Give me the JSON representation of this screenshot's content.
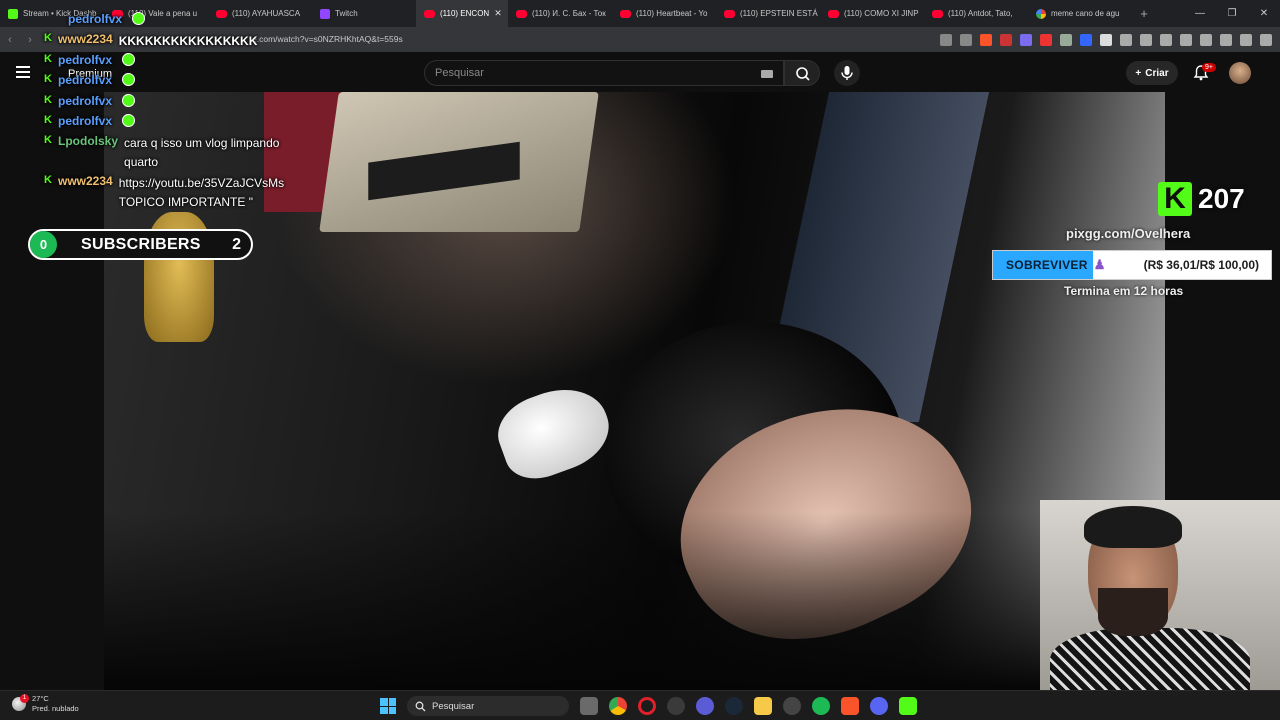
{
  "browser": {
    "tabs": [
      {
        "label": "Stream • Kick Dashb",
        "icon": "kick-icon",
        "color": "#53fc18"
      },
      {
        "label": "(110) Vale a pena u",
        "icon": "youtube-icon",
        "color": "#ff0033"
      },
      {
        "label": "(110) AYAHUASCA",
        "icon": "youtube-icon",
        "color": "#ff0033"
      },
      {
        "label": "Twitch",
        "icon": "twitch-icon",
        "color": "#9146ff"
      },
      {
        "label": "(110) ENCON",
        "icon": "youtube-icon",
        "color": "#ff0033",
        "active": true
      },
      {
        "label": "(110) И. С. Бах - Ток",
        "icon": "youtube-icon",
        "color": "#ff0033"
      },
      {
        "label": "(110) Heartbeat - Yo",
        "icon": "youtube-icon",
        "color": "#ff0033"
      },
      {
        "label": "(110) EPSTEIN ESTÁ",
        "icon": "youtube-icon",
        "color": "#ff0033"
      },
      {
        "label": "(110) COMO XI JINP",
        "icon": "youtube-icon",
        "color": "#ff0033"
      },
      {
        "label": "(110) Antdot, Tato,",
        "icon": "youtube-icon",
        "color": "#ff0033"
      },
      {
        "label": "meme cano de agu",
        "icon": "google-icon",
        "color": "#4285f4"
      }
    ],
    "new_tab": "+",
    "window_controls": {
      "minimize": "—",
      "restore": "❐",
      "close": "✕"
    },
    "url": "e.com/watch?v=s0NZRHKhtAQ&t=559s"
  },
  "youtube": {
    "premium_label": "Premium",
    "search_placeholder": "Pesquisar",
    "create_label": "Criar",
    "notification_count": "9+"
  },
  "chat": {
    "messages": [
      {
        "user": "pedrolfvx",
        "user_color": "#5aa0ff",
        "text": ""
      },
      {
        "user": "www2234",
        "user_color": "#f0c070",
        "text": "KKKKKKKKKKKKKKKK"
      },
      {
        "user": "pedrolfvx",
        "user_color": "#5aa0ff",
        "text": ""
      },
      {
        "user": "pedrolfvx",
        "user_color": "#5aa0ff",
        "text": ""
      },
      {
        "user": "pedrolfvx",
        "user_color": "#5aa0ff",
        "text": ""
      },
      {
        "user": "pedrolfvx",
        "user_color": "#5aa0ff",
        "text": ""
      },
      {
        "user": "Lpodolsky",
        "user_color": "#6ac47a",
        "text": "cara q isso um vlog limpando quarto"
      },
      {
        "user": "www2234",
        "user_color": "#f0c070",
        "text": "https://youtu.be/35VZaJCVsMs TOPICO IMPORTANTE \""
      }
    ]
  },
  "subscribers_goal": {
    "current": "0",
    "label": "SUBSCRIBERS",
    "goal": "2"
  },
  "viewer_count": {
    "value": "207",
    "icon": "kick-icon"
  },
  "donation_goal": {
    "url": "pixgg.com/Ovelhera",
    "name": "SOBREVIVER",
    "icon": "person-meditating-icon",
    "values": "(R$ 36,01/R$ 100,00)",
    "progress": 0.36,
    "fill_color": "#2aa7ff",
    "ends": "Termina em 12 horas"
  },
  "taskbar": {
    "weather_temp": "27°C",
    "weather_desc": "Pred. nublado",
    "weather_badge": "1",
    "search_label": "Pesquisar",
    "apps": [
      "task-view-icon",
      "chrome-icon",
      "opera-icon",
      "obs-icon",
      "app-icon",
      "steam-icon",
      "file-explorer-icon",
      "app-icon",
      "spotify-icon",
      "brave-icon",
      "discord-icon",
      "kick-icon"
    ]
  }
}
